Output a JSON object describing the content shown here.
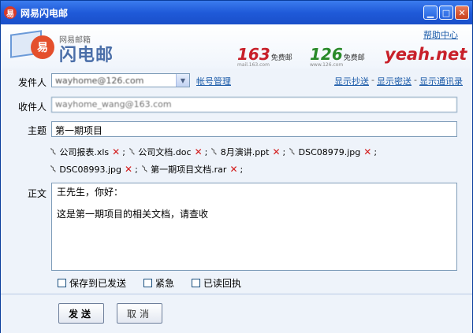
{
  "window": {
    "title": "网易闪电邮",
    "app_icon_glyph": "易",
    "minimize_glyph": "▁",
    "maximize_glyph": "□",
    "close_glyph": "✕"
  },
  "header": {
    "logo_small": "网易邮箱",
    "logo_big": "闪电邮",
    "logo_swirl_glyph": "易",
    "help": "帮助中心",
    "brands": [
      {
        "num": "163",
        "free": "免费邮",
        "sub": "mail.163.com"
      },
      {
        "num": "126",
        "free": "免费邮",
        "sub": "www.126.com"
      },
      {
        "num": "yeah.net",
        "free": "",
        "sub": ""
      }
    ]
  },
  "compose": {
    "from_label": "发件人",
    "from_value": "wayhome@126.com",
    "account_manage": "帐号管理",
    "show_cc": "显示抄送",
    "show_bcc": "显示密送",
    "show_contacts": "显示通讯录",
    "link_sep": "-",
    "to_label": "收件人",
    "to_value": "wayhome_wang@163.com",
    "subject_label": "主题",
    "subject_value": "第一期项目",
    "attachments_row1": [
      {
        "name": "公司报表.xls"
      },
      {
        "name": "公司文档.doc"
      },
      {
        "name": "8月演讲.ppt"
      },
      {
        "name": "DSC08979.jpg"
      }
    ],
    "attachments_row2": [
      {
        "name": "DSC08993.jpg"
      },
      {
        "name": "第一期项目文档.rar"
      }
    ],
    "body_label": "正文",
    "body_line1": "王先生，你好：",
    "body_line2": "这是第一期项目的相关文档，请查收",
    "options": {
      "save_sent": "保存到已发送",
      "urgent": "紧急",
      "read_receipt": "已读回执"
    },
    "send": "发送",
    "cancel": "取消"
  },
  "icons": {
    "attachment": "paperclip-icon",
    "delete": "delete-x-icon"
  },
  "colors": {
    "titlebar": "#1f5ad9",
    "link": "#1a5aa8",
    "delete_x": "#d21a1a",
    "brand_163": "#c8202a",
    "brand_126": "#2a8a2a"
  }
}
